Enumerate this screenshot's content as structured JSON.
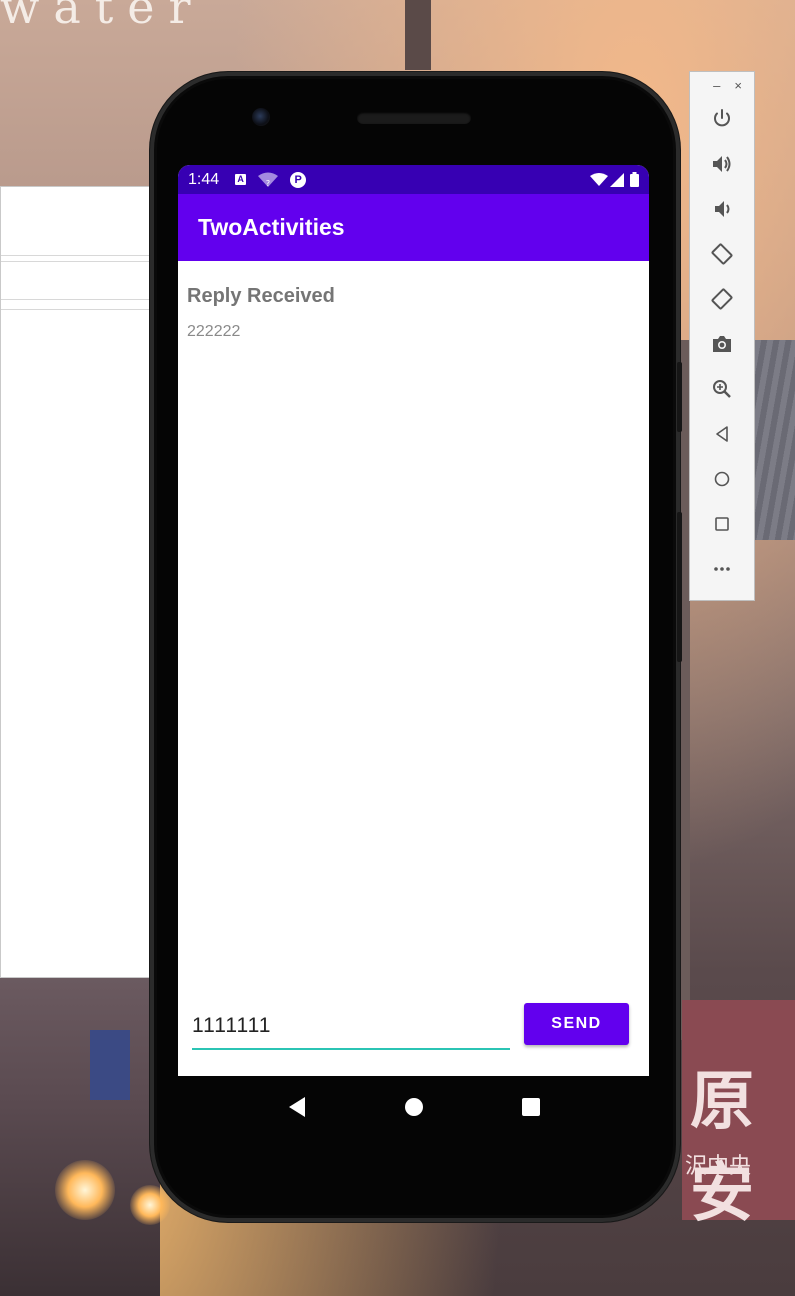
{
  "background": {
    "title_text": "water"
  },
  "phone": {
    "status_bar": {
      "time": "1:44",
      "a_badge": "A",
      "p_badge": "P"
    },
    "app_bar": {
      "title": "TwoActivities"
    },
    "content": {
      "reply_header": "Reply Received",
      "reply_message": "222222",
      "message_input_value": "1111111",
      "send_label": "SEND"
    },
    "nav": [
      "back",
      "home",
      "overview"
    ]
  },
  "toolbar": {
    "window_controls": {
      "minimize": "–",
      "close": "×"
    },
    "items": [
      "power-icon",
      "volume-up-icon",
      "volume-down-icon",
      "rotate-left-icon",
      "rotate-right-icon",
      "camera-icon",
      "zoom-icon",
      "back-icon",
      "home-icon",
      "overview-icon",
      "more-icon"
    ]
  },
  "colors": {
    "status_bar": "#3700b3",
    "app_bar": "#6200ee",
    "accent": "#2bc4b4"
  }
}
